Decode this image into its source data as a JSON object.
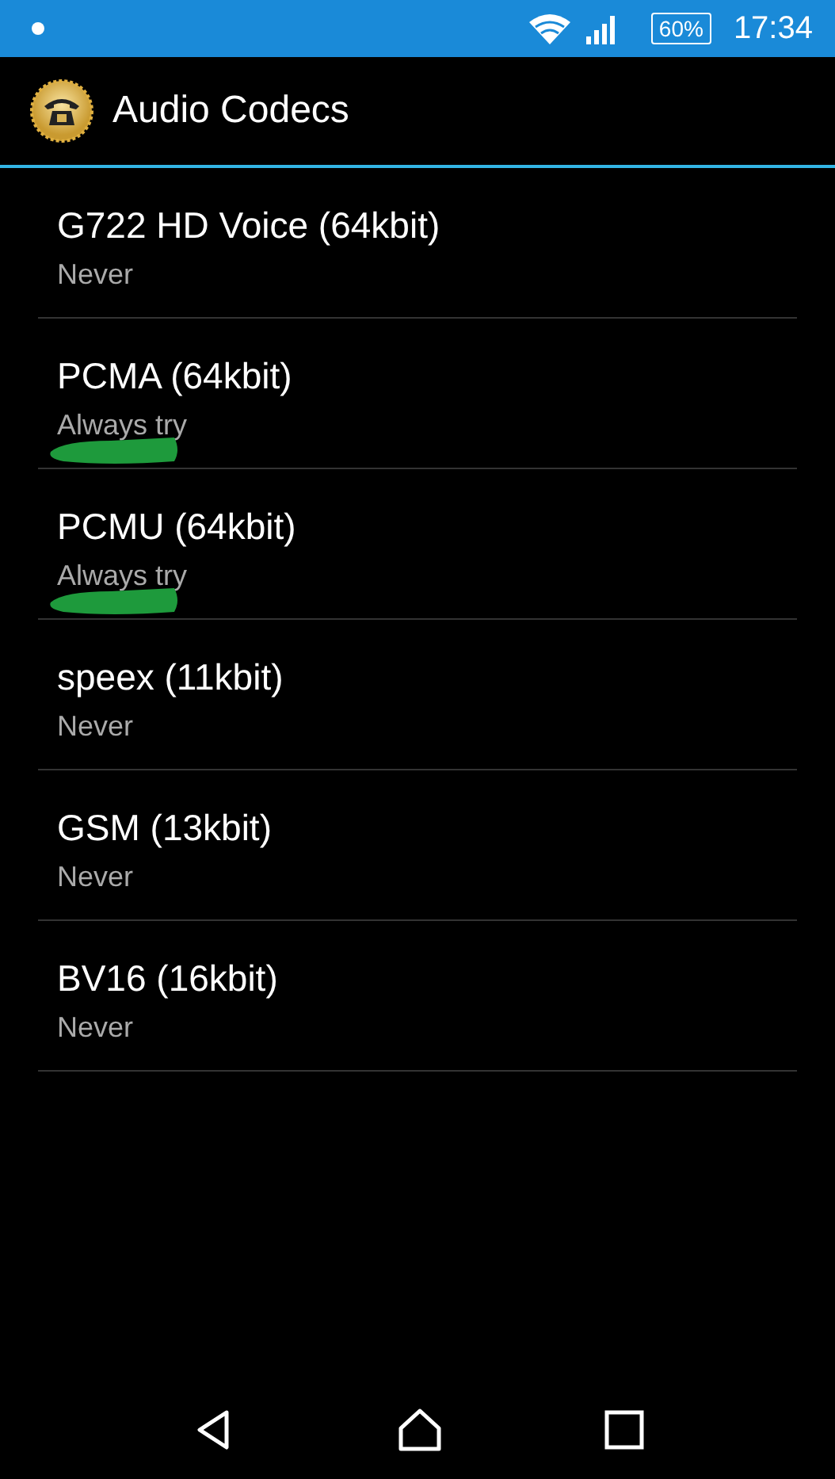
{
  "status_bar": {
    "notification_dot": true,
    "battery": "60%",
    "time": "17:34"
  },
  "app_bar": {
    "title": "Audio Codecs"
  },
  "codecs": [
    {
      "name": "G722 HD Voice (64kbit)",
      "mode": "Never",
      "scribbled": false
    },
    {
      "name": "PCMA (64kbit)",
      "mode": "Always try",
      "scribbled": true
    },
    {
      "name": "PCMU (64kbit)",
      "mode": "Always try",
      "scribbled": true
    },
    {
      "name": "speex (11kbit)",
      "mode": "Never",
      "scribbled": false
    },
    {
      "name": "GSM (13kbit)",
      "mode": "Never",
      "scribbled": false
    },
    {
      "name": "BV16 (16kbit)",
      "mode": "Never",
      "scribbled": false
    }
  ]
}
